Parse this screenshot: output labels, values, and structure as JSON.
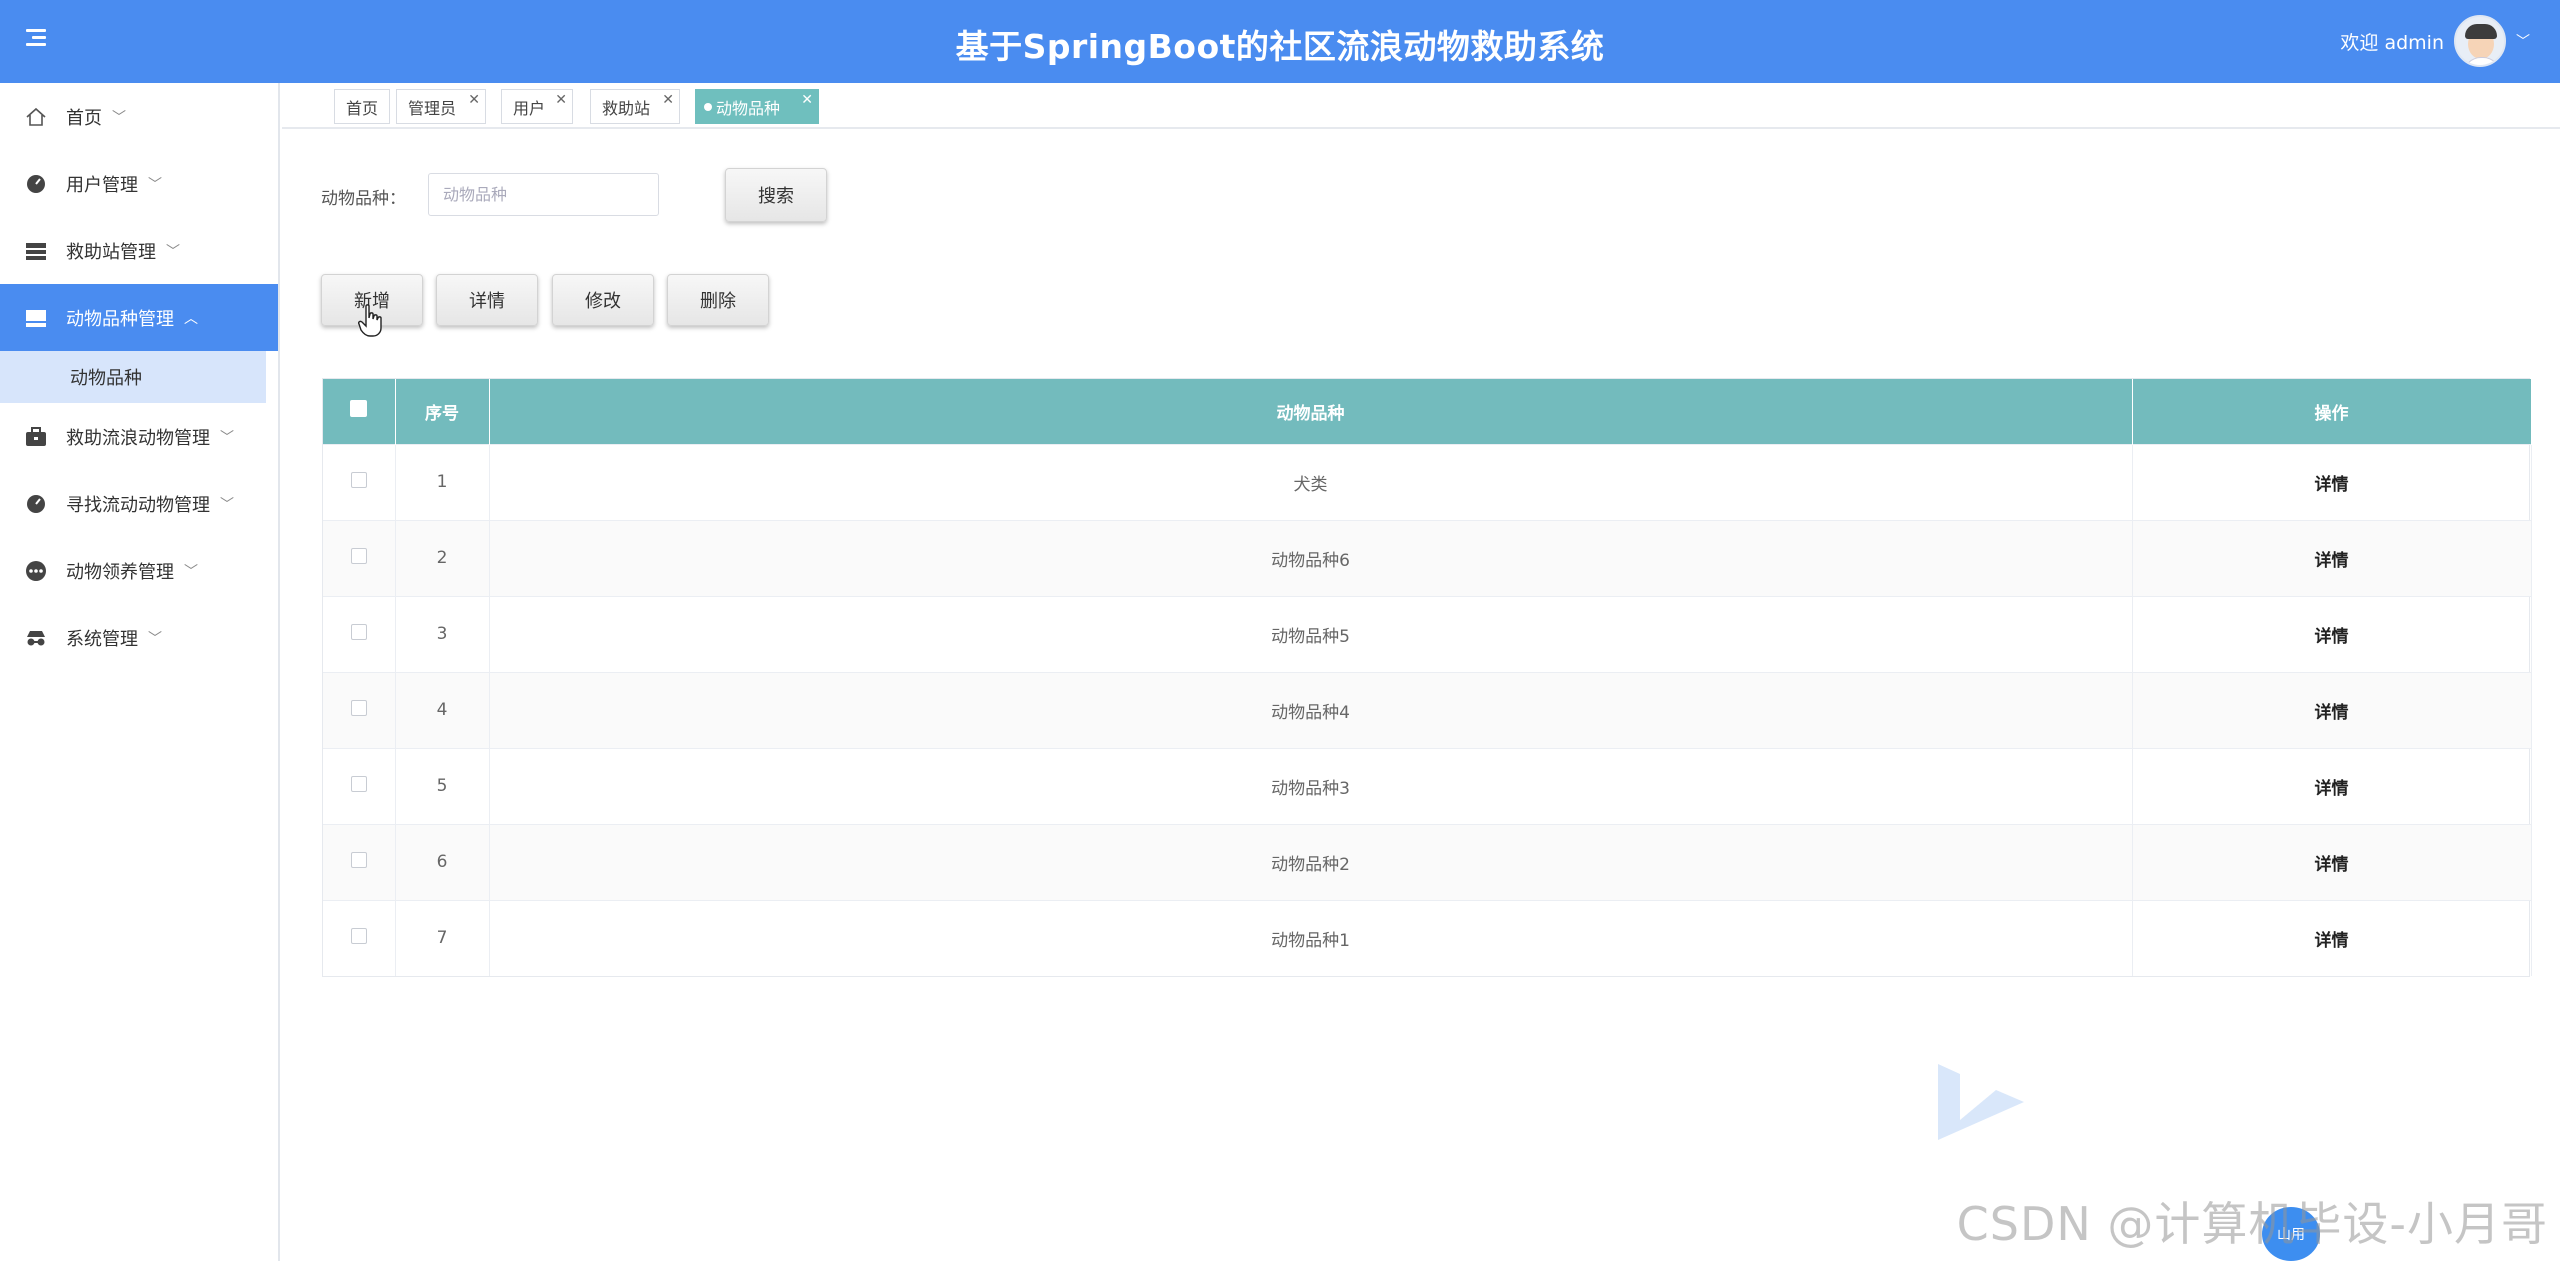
{
  "header": {
    "title": "基于SpringBoot的社区流浪动物救助系统",
    "welcome": "欢迎 admin",
    "caret": "﹀"
  },
  "sidebar": {
    "items": [
      {
        "label": "首页",
        "icon": "home-icon"
      },
      {
        "label": "用户管理",
        "icon": "gauge-icon"
      },
      {
        "label": "救助站管理",
        "icon": "list-icon"
      },
      {
        "label": "动物品种管理",
        "icon": "panel-icon",
        "active": true
      },
      {
        "label": "救助流浪动物管理",
        "icon": "briefcase-icon"
      },
      {
        "label": "寻找流动动物管理",
        "icon": "gauge-icon"
      },
      {
        "label": "动物领养管理",
        "icon": "more-icon"
      },
      {
        "label": "系统管理",
        "icon": "incognito-icon"
      }
    ],
    "sub_item": "动物品种",
    "chevron_down": "﹀",
    "chevron_up": "︿"
  },
  "tabs": [
    {
      "label": "首页"
    },
    {
      "label": "管理员"
    },
    {
      "label": "用户"
    },
    {
      "label": "救助站"
    },
    {
      "label": "动物品种",
      "active": true
    }
  ],
  "search": {
    "label": "动物品种：",
    "placeholder": "动物品种",
    "button": "搜索"
  },
  "actions": {
    "add": "新增",
    "detail": "详情",
    "edit": "修改",
    "delete": "删除"
  },
  "table": {
    "headers": {
      "index": "序号",
      "breed": "动物品种",
      "ops": "操作"
    },
    "rows": [
      {
        "index": "1",
        "breed": "犬类",
        "op": "详情"
      },
      {
        "index": "2",
        "breed": "动物品种6",
        "op": "详情"
      },
      {
        "index": "3",
        "breed": "动物品种5",
        "op": "详情"
      },
      {
        "index": "4",
        "breed": "动物品种4",
        "op": "详情"
      },
      {
        "index": "5",
        "breed": "动物品种3",
        "op": "详情"
      },
      {
        "index": "6",
        "breed": "动物品种2",
        "op": "详情"
      },
      {
        "index": "7",
        "breed": "动物品种1",
        "op": "详情"
      }
    ]
  },
  "watermark": {
    "text": "CSDN @计算机毕设-小月哥",
    "badge": "山用"
  },
  "colors": {
    "header": "#4a8cf0",
    "table_header": "#73bbbd",
    "active_tab": "#6fbfbe",
    "sub_item_bg": "#d7e5fb"
  }
}
